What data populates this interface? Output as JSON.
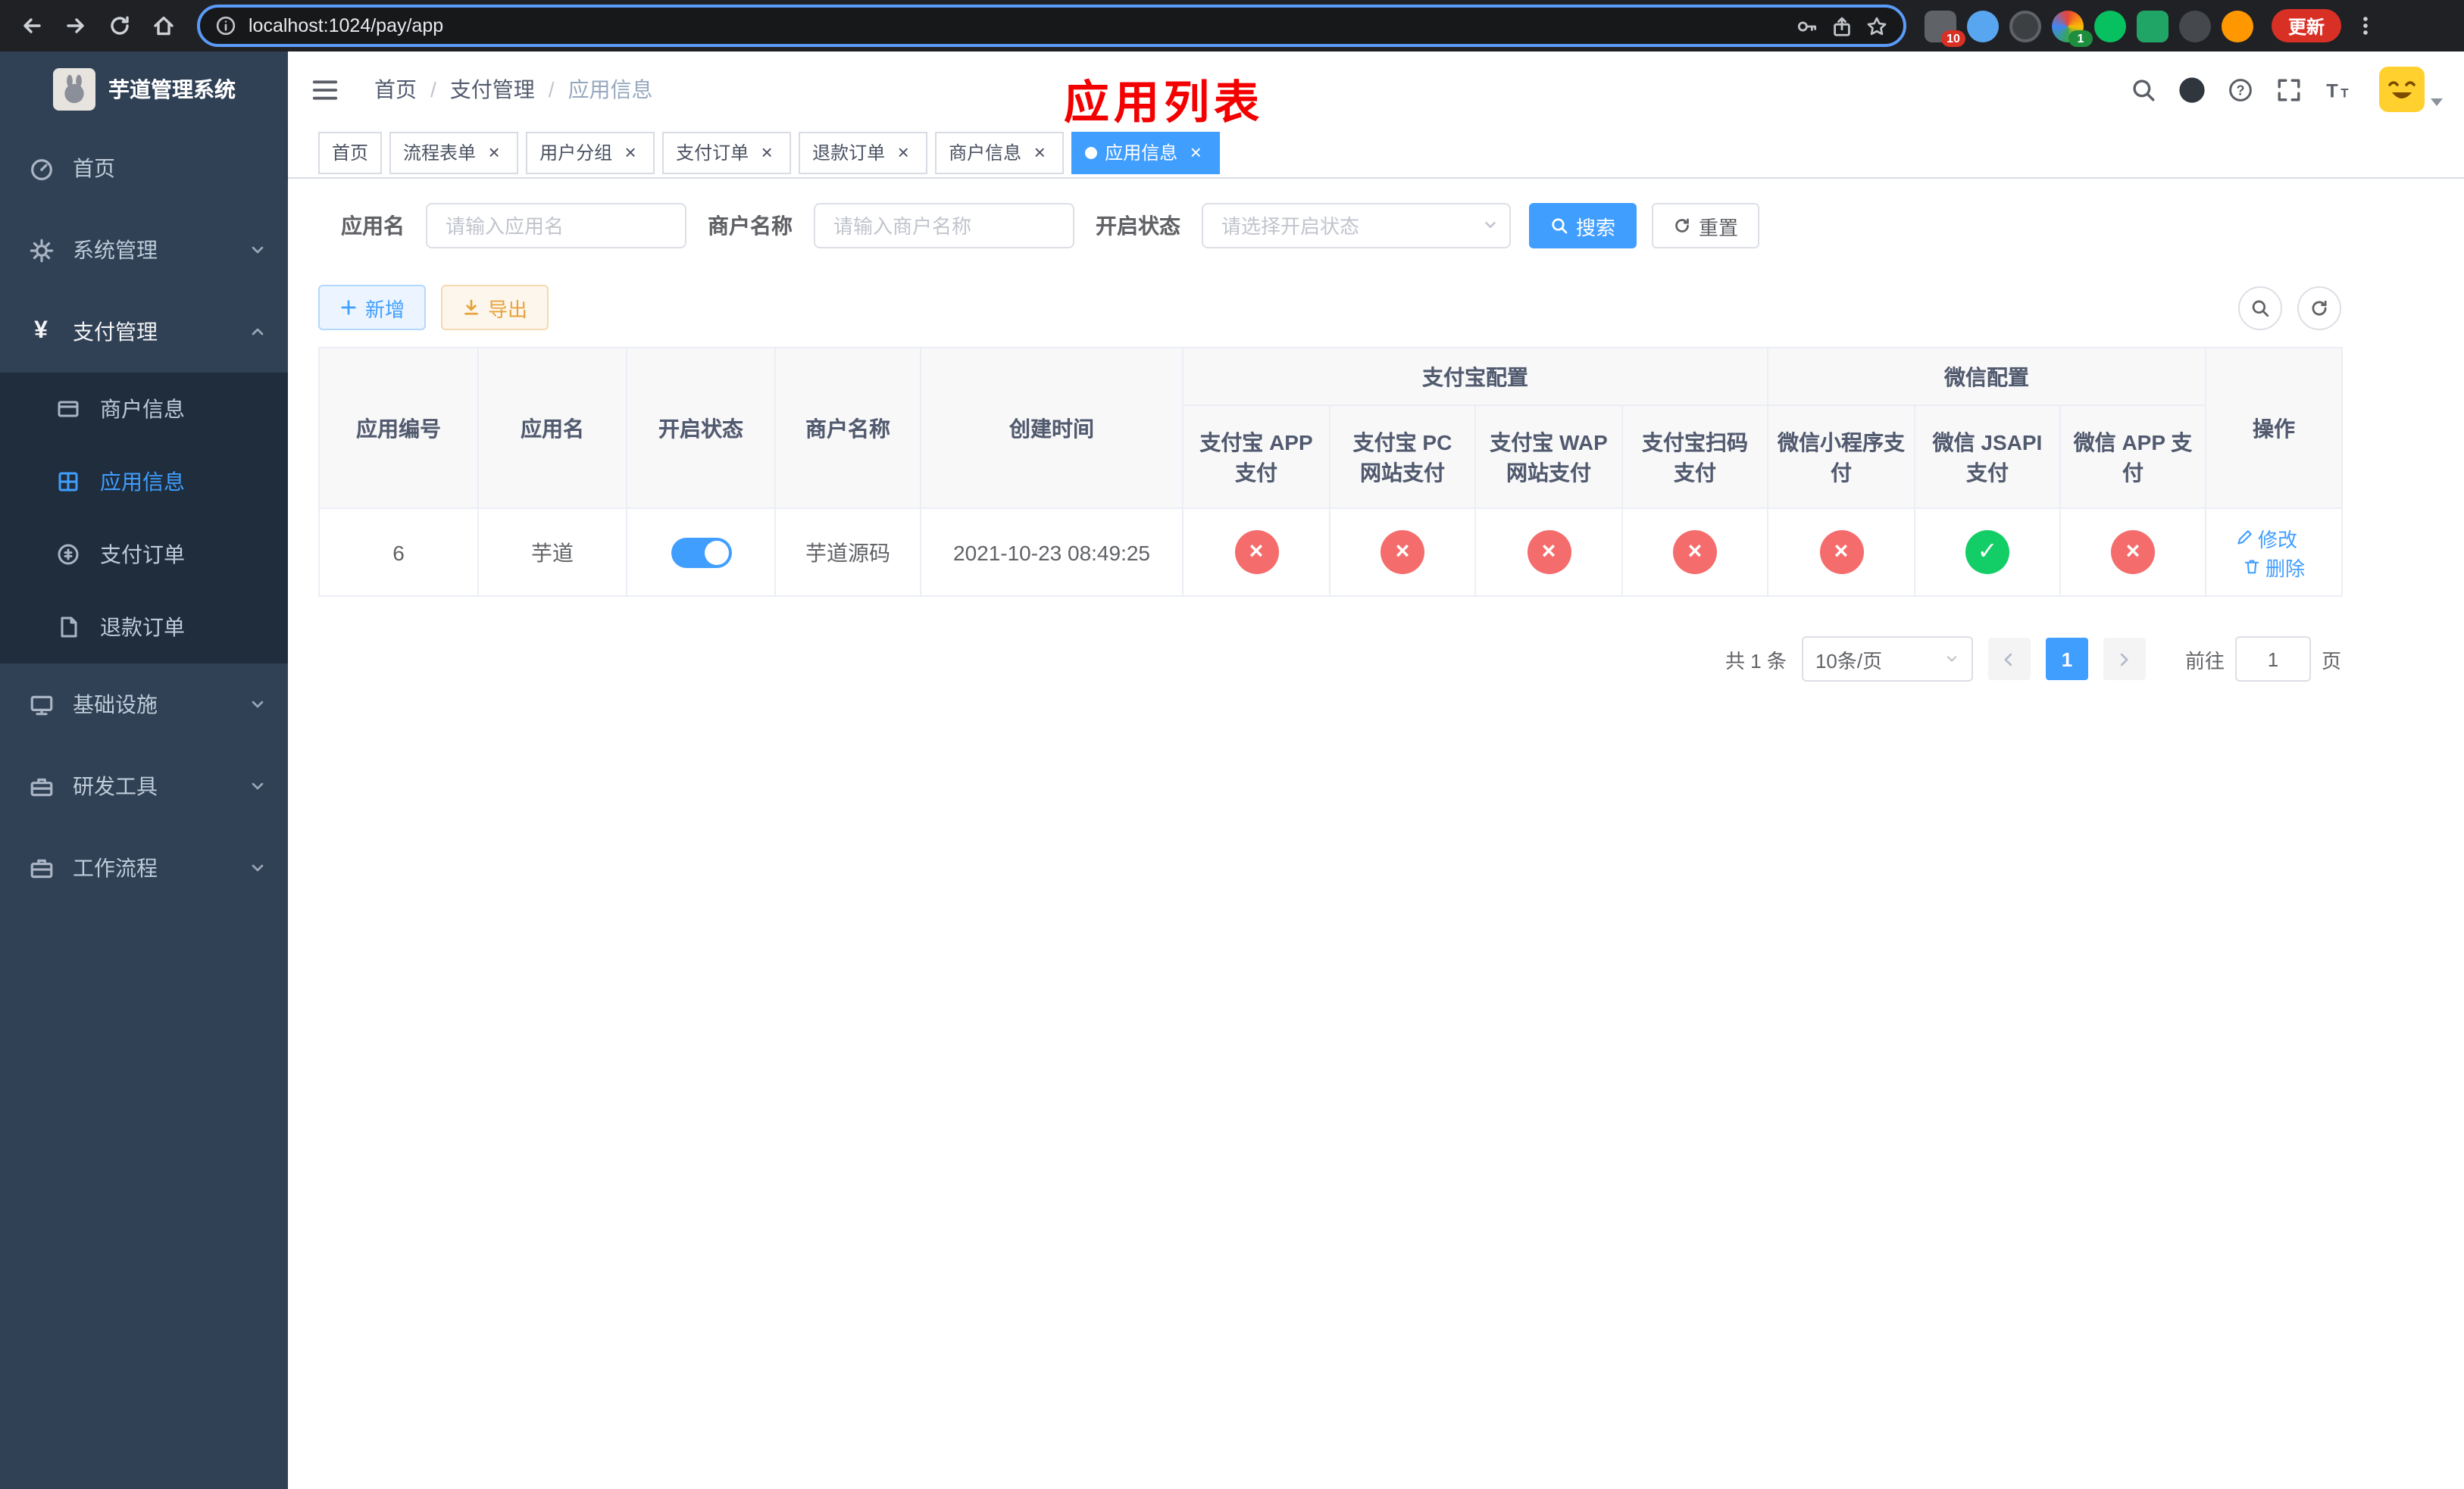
{
  "browser": {
    "url": "localhost:1024/pay/app",
    "update_button": "更新",
    "ext_badge_puzzle": "10",
    "ext_badge_avatar": "1"
  },
  "sidebar": {
    "logo_title": "芋道管理系统",
    "menu": {
      "home": "首页",
      "system": "系统管理",
      "pay": "支付管理",
      "pay_children": {
        "merchant": "商户信息",
        "app": "应用信息",
        "order": "支付订单",
        "refund": "退款订单"
      },
      "infra": "基础设施",
      "dev_tools": "研发工具",
      "workflow": "工作流程"
    }
  },
  "navbar": {
    "breadcrumb": {
      "home": "首页",
      "sep": "/",
      "pay": "支付管理",
      "current": "应用信息"
    },
    "page_title": "应用列表"
  },
  "tabs": [
    {
      "label": "首页",
      "closable": false,
      "active": false
    },
    {
      "label": "流程表单",
      "closable": true,
      "active": false
    },
    {
      "label": "用户分组",
      "closable": true,
      "active": false
    },
    {
      "label": "支付订单",
      "closable": true,
      "active": false
    },
    {
      "label": "退款订单",
      "closable": true,
      "active": false
    },
    {
      "label": "商户信息",
      "closable": true,
      "active": false
    },
    {
      "label": "应用信息",
      "closable": true,
      "active": true
    }
  ],
  "filters": {
    "app_name_label": "应用名",
    "app_name_placeholder": "请输入应用名",
    "merchant_label": "商户名称",
    "merchant_placeholder": "请输入商户名称",
    "status_label": "开启状态",
    "status_placeholder": "请选择开启状态",
    "search_button": "搜索",
    "reset_button": "重置"
  },
  "toolbar": {
    "add": "新增",
    "export": "导出"
  },
  "table": {
    "groups": {
      "alipay": "支付宝配置",
      "wechat": "微信配置"
    },
    "columns": [
      "应用编号",
      "应用名",
      "开启状态",
      "商户名称",
      "创建时间",
      "支付宝 APP 支付",
      "支付宝 PC 网站支付",
      "支付宝 WAP 网站支付",
      "支付宝扫码支付",
      "微信小程序支付",
      "微信 JSAPI 支付",
      "微信 APP 支付",
      "操作"
    ],
    "row": {
      "id": "6",
      "name": "芋道",
      "enabled": true,
      "merchant": "芋道源码",
      "created_at": "2021-10-23 08:49:25",
      "alipay_app": false,
      "alipay_pc": false,
      "alipay_wap": false,
      "alipay_qr": false,
      "wx_lite": false,
      "wx_jsapi": true,
      "wx_app": false,
      "edit": "修改",
      "delete": "删除"
    }
  },
  "pagination": {
    "total": "共 1 条",
    "page_size": "10条/页",
    "page": "1",
    "goto": "前往",
    "goto_value": "1",
    "unit": "页"
  },
  "icons": {
    "disabled_glyph": "×",
    "enabled_glyph": "✓",
    "pay_glyph": "¥",
    "close_glyph": "×"
  },
  "colors": {
    "accent": "#409eff",
    "danger": "#f56c6c",
    "success": "#13ce66",
    "warning": "#e6a23c",
    "title_red": "#f40000",
    "sidebar_bg": "#304156",
    "submenu_bg": "#1f2d3d"
  }
}
